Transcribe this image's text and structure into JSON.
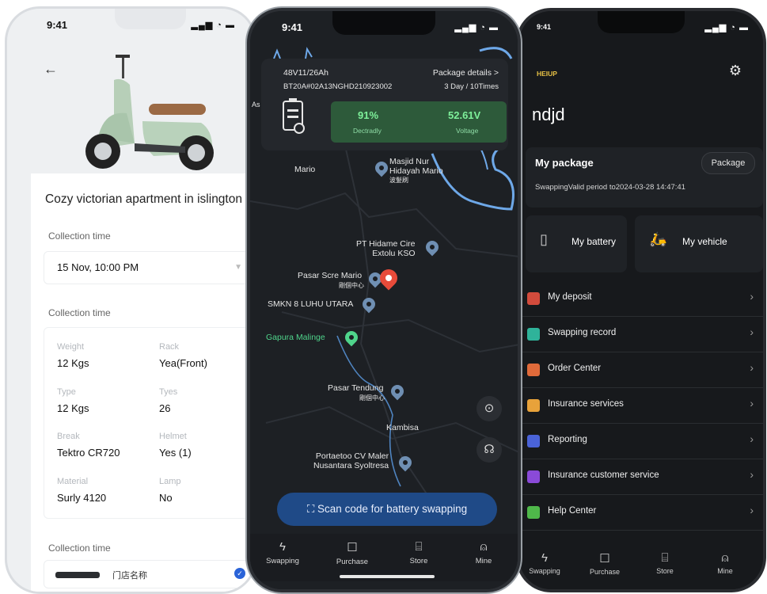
{
  "left": {
    "time": "9:41",
    "title": "Cozy victorian apartment in islington",
    "collection_label_1": "Collection time",
    "collection_value": "15 Nov, 10:00 PM",
    "collection_label_2": "Collection time",
    "specs": [
      {
        "key": "Weight",
        "value": "12 Kgs"
      },
      {
        "key": "Rack",
        "value": "Yea(Front)"
      },
      {
        "key": "Type",
        "value": "12 Kgs"
      },
      {
        "key": "Tyes",
        "value": "26"
      },
      {
        "key": "Break",
        "value": "Tektro CR720"
      },
      {
        "key": "Helmet",
        "value": "Yes (1)"
      },
      {
        "key": "Material",
        "value": "Surly 4120"
      },
      {
        "key": "Lamp",
        "value": "No"
      }
    ],
    "collection_label_3": "Collection time",
    "store_text": "门店名称"
  },
  "middle": {
    "time": "9:41",
    "battery_spec": "48V11/26Ah",
    "package_details": "Package details >",
    "battery_id": "BT20A#02A13NGHD210923002",
    "usage": "3 Day / 10Times",
    "charge_pct": "91%",
    "charge_label": "Dectradly",
    "voltage": "52.61V",
    "voltage_label": "Voltage",
    "map_labels": {
      "mario": "Mario",
      "masjid": "Masjid Nur\nHidayah Mario",
      "masjid_sub": "波髪刷",
      "pt": "PT Hidame Cire\nExtolu KSO",
      "pasar_scre": "Pasar Scre Mario",
      "pasar_scre_sub": "剛個中心",
      "smkn": "SMKN 8 LUHU UTARA",
      "gapura": "Gapura Malinge",
      "pasar_tendung": "Pasar Tendung",
      "pasar_tendung_sub": "剛個中心",
      "kambisa": "Kambisa",
      "portaetoo": "Portaetoo CV Maler\nNusantara Syoltresa",
      "corner": "As"
    },
    "scan_label": "Scan code for battery swapping",
    "tabs": [
      "Swapping",
      "Purchase",
      "Store",
      "Mine"
    ]
  },
  "right": {
    "time": "9:41",
    "logo": "HEIUP",
    "user_name": "ndjd",
    "package_title": "My package",
    "package_button": "Package",
    "valid_text": "SwappingValid period to2024-03-28 14:47:41",
    "tile_battery": "My battery",
    "tile_vehicle": "My vehicle",
    "menu": [
      {
        "label": "My deposit",
        "color": "#d24b3c"
      },
      {
        "label": "Swapping record",
        "color": "#2fb39a"
      },
      {
        "label": "Order Center",
        "color": "#e06a3a"
      },
      {
        "label": "Insurance services",
        "color": "#e8a23a"
      },
      {
        "label": "Reporting",
        "color": "#4a63d8"
      },
      {
        "label": "Insurance customer service",
        "color": "#8a4ad8"
      },
      {
        "label": "Help Center",
        "color": "#4fb84a"
      }
    ],
    "tabs": [
      "Swapping",
      "Purchase",
      "Store",
      "Mine"
    ]
  }
}
